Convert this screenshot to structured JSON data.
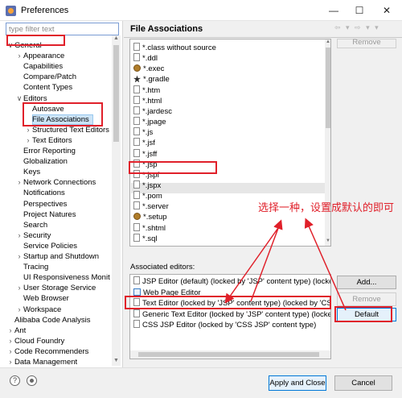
{
  "window": {
    "title": "Preferences",
    "minimize": "—",
    "maximize": "☐",
    "close": "✕"
  },
  "filter": {
    "placeholder": "type filter text",
    "value": ""
  },
  "tree": [
    {
      "label": "General",
      "twisty": "∨",
      "level": 0
    },
    {
      "label": "Appearance",
      "twisty": "›",
      "level": 1
    },
    {
      "label": "Capabilities",
      "twisty": "",
      "level": 1
    },
    {
      "label": "Compare/Patch",
      "twisty": "",
      "level": 1
    },
    {
      "label": "Content Types",
      "twisty": "",
      "level": 1
    },
    {
      "label": "Editors",
      "twisty": "∨",
      "level": 1
    },
    {
      "label": "Autosave",
      "twisty": "",
      "level": 2
    },
    {
      "label": "File Associations",
      "twisty": "",
      "level": 2
    },
    {
      "label": "Structured Text Editors",
      "twisty": "›",
      "level": 2
    },
    {
      "label": "Text Editors",
      "twisty": "›",
      "level": 2
    },
    {
      "label": "Error Reporting",
      "twisty": "",
      "level": 1
    },
    {
      "label": "Globalization",
      "twisty": "",
      "level": 1
    },
    {
      "label": "Keys",
      "twisty": "",
      "level": 1
    },
    {
      "label": "Network Connections",
      "twisty": "›",
      "level": 1
    },
    {
      "label": "Notifications",
      "twisty": "",
      "level": 1
    },
    {
      "label": "Perspectives",
      "twisty": "",
      "level": 1
    },
    {
      "label": "Project Natures",
      "twisty": "",
      "level": 1
    },
    {
      "label": "Search",
      "twisty": "",
      "level": 1
    },
    {
      "label": "Security",
      "twisty": "›",
      "level": 1
    },
    {
      "label": "Service Policies",
      "twisty": "",
      "level": 1
    },
    {
      "label": "Startup and Shutdown",
      "twisty": "›",
      "level": 1
    },
    {
      "label": "Tracing",
      "twisty": "",
      "level": 1
    },
    {
      "label": "UI Responsiveness Monit",
      "twisty": "",
      "level": 1
    },
    {
      "label": "User Storage Service",
      "twisty": "›",
      "level": 1
    },
    {
      "label": "Web Browser",
      "twisty": "",
      "level": 1
    },
    {
      "label": "Workspace",
      "twisty": "›",
      "level": 1
    },
    {
      "label": "Alibaba Code Analysis",
      "twisty": "",
      "level": 0
    },
    {
      "label": "Ant",
      "twisty": "›",
      "level": 0
    },
    {
      "label": "Cloud Foundry",
      "twisty": "›",
      "level": 0
    },
    {
      "label": "Code Recommenders",
      "twisty": "›",
      "level": 0
    },
    {
      "label": "Data Management",
      "twisty": "›",
      "level": 0
    }
  ],
  "page": {
    "title": "File Associations",
    "nav_icons": "⇦ ▾ ⇨ ▾ ▾",
    "remove_top_label": "Remove",
    "file_types": [
      {
        "label": "*.class without source",
        "icon": "file-icon"
      },
      {
        "label": "*.ddl",
        "icon": "file-icon"
      },
      {
        "label": "*.exec",
        "icon": "gear-icon"
      },
      {
        "label": "*.gradle",
        "icon": "star-icon"
      },
      {
        "label": "*.htm",
        "icon": "file-icon"
      },
      {
        "label": "*.html",
        "icon": "file-icon"
      },
      {
        "label": "*.jardesc",
        "icon": "file-icon"
      },
      {
        "label": "*.jpage",
        "icon": "file-icon"
      },
      {
        "label": "*.js",
        "icon": "file-icon"
      },
      {
        "label": "*.jsf",
        "icon": "file-icon"
      },
      {
        "label": "*.jsff",
        "icon": "file-icon"
      },
      {
        "label": "*.jsp",
        "icon": "file-icon"
      },
      {
        "label": "*.jspf",
        "icon": "file-icon"
      },
      {
        "label": "*.jspx",
        "icon": "file-icon"
      },
      {
        "label": "*.pom",
        "icon": "file-icon"
      },
      {
        "label": "*.server",
        "icon": "file-icon"
      },
      {
        "label": "*.setup",
        "icon": "gear-icon"
      },
      {
        "label": "*.shtml",
        "icon": "file-icon"
      },
      {
        "label": "*.sql",
        "icon": "file-icon"
      }
    ],
    "associated_editors_label": "Associated editors:",
    "editors": [
      {
        "label": "JSP Editor (default) (locked by 'JSP' content type) (locked",
        "icon": "file-icon"
      },
      {
        "label": "Web Page Editor",
        "icon": "web-icon"
      },
      {
        "label": "Text Editor (locked by 'JSP' content type) (locked by 'CSS",
        "icon": "file-icon"
      },
      {
        "label": "Generic Text Editor (locked by 'JSP' content type) (locke",
        "icon": "file-icon"
      },
      {
        "label": "CSS JSP Editor (locked by 'CSS JSP' content type)",
        "icon": "file-icon"
      }
    ],
    "add_label": "Add...",
    "remove_label": "Remove",
    "default_label": "Default"
  },
  "annotation": "选择一种，设置成默认的即可",
  "footer": {
    "help": "?",
    "apply_close_label": "Apply and Close",
    "cancel_label": "Cancel"
  },
  "colors": {
    "highlight": "#e0202a",
    "selection": "#cce4f7"
  }
}
